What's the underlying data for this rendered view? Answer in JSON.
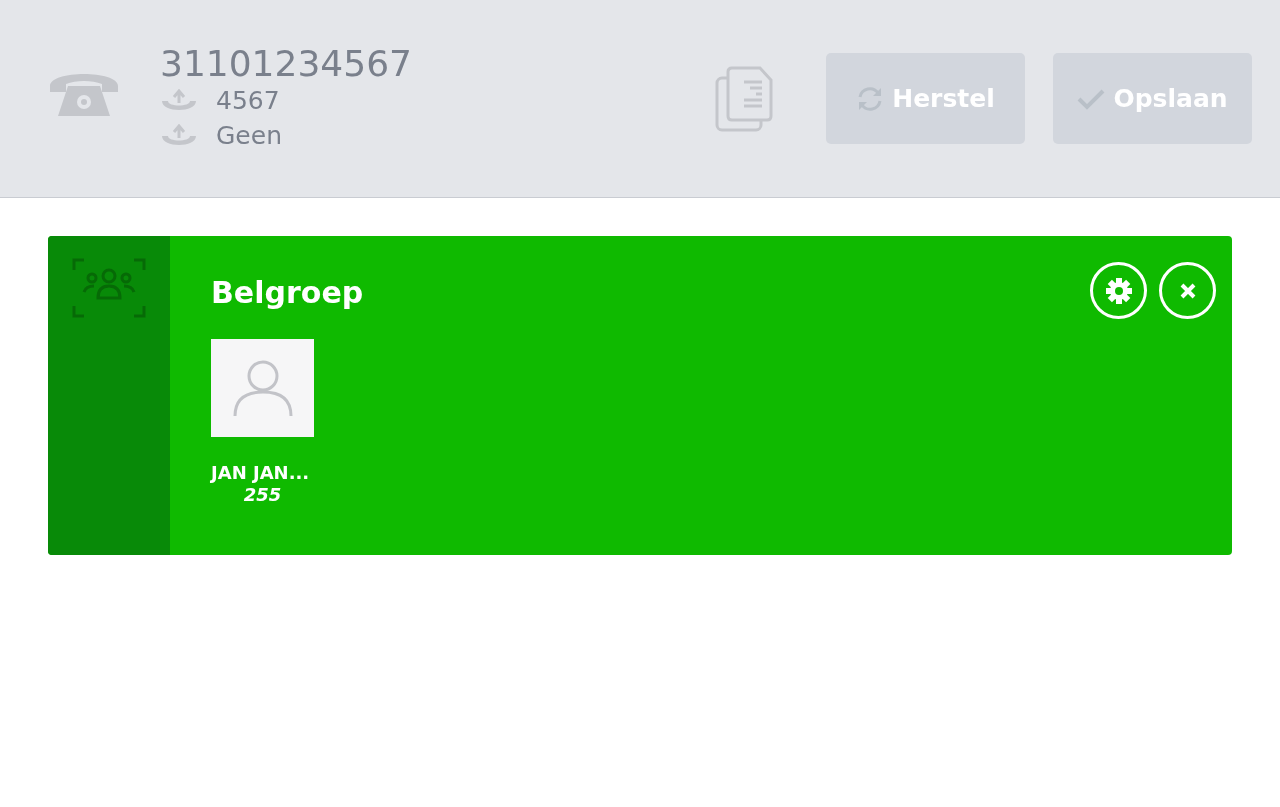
{
  "header": {
    "number": "31101234567",
    "lines": [
      {
        "text": "4567"
      },
      {
        "text": "Geen"
      }
    ],
    "buttons": [
      {
        "kind": "reset",
        "label": "Herstel",
        "disabled": true
      },
      {
        "kind": "save",
        "label": "Opslaan",
        "disabled": true
      }
    ]
  },
  "group": {
    "title": "Belgroep",
    "members": [
      {
        "name": "JAN JAN...",
        "extension": "255"
      }
    ]
  }
}
